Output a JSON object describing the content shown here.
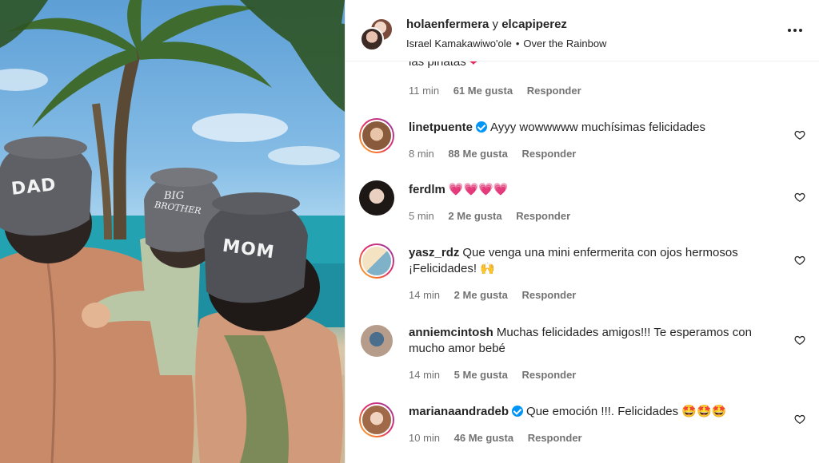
{
  "header": {
    "user1": "holaenfermera",
    "joiner": "y",
    "user2": "elcapiperez",
    "artist": "Israel Kamakawiwo'ole",
    "separator": "•",
    "song": "Over the Rainbow"
  },
  "photo": {
    "cap_dad": "DAD",
    "cap_big": "BIG",
    "cap_brother": "BROTHER",
    "cap_mom": "MOM"
  },
  "partial": {
    "text": "las piñatas",
    "emoji": "❤",
    "time": "11 min",
    "likes": "61 Me gusta",
    "reply": "Responder"
  },
  "comments": [
    {
      "user": "linetpuente",
      "verified": true,
      "text": "Ayyy wowwwww muchísimas felicidades",
      "time": "8 min",
      "likes": "88 Me gusta",
      "reply": "Responder"
    },
    {
      "user": "ferdlm",
      "verified": false,
      "text": "💗💗💗💗",
      "time": "5 min",
      "likes": "2 Me gusta",
      "reply": "Responder"
    },
    {
      "user": "yasz_rdz",
      "verified": false,
      "text": "Que venga una mini enfermerita con ojos hermosos ¡Felicidades! 🙌",
      "time": "14 min",
      "likes": "2 Me gusta",
      "reply": "Responder"
    },
    {
      "user": "anniemcintosh",
      "verified": false,
      "text": "Muchas felicidades amigos!!! Te esperamos con mucho amor bebé",
      "time": "14 min",
      "likes": "5 Me gusta",
      "reply": "Responder"
    },
    {
      "user": "marianaandradeb",
      "verified": true,
      "text": "Que emoción !!!. Felicidades 🤩🤩🤩",
      "time": "10 min",
      "likes": "46 Me gusta",
      "reply": "Responder"
    }
  ],
  "colors": {
    "verified": "#0095f6",
    "story_ring": "#e1306c",
    "meta_text": "#737373",
    "emoji_heart": "#e8265e"
  },
  "icons": {
    "more": "more-options-icon",
    "like": "heart-outline-icon",
    "verified": "verified-badge-icon"
  }
}
